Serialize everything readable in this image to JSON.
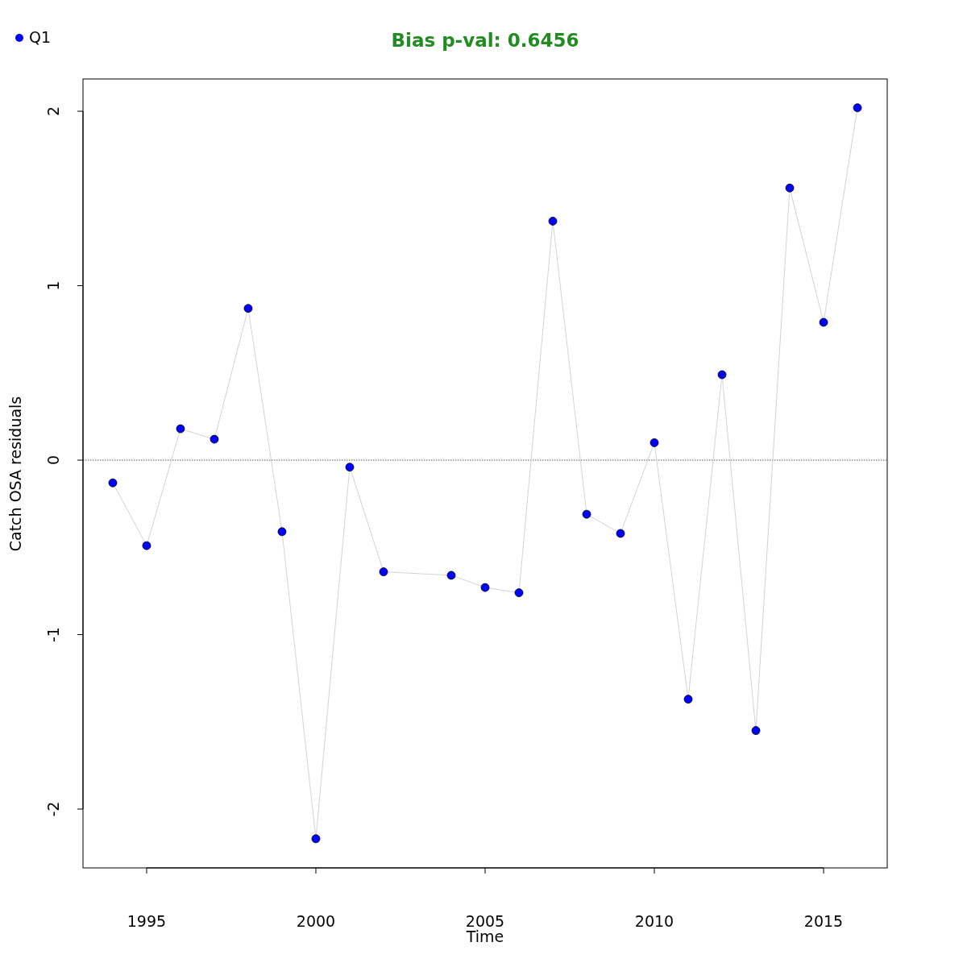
{
  "chart_data": {
    "type": "line",
    "title": "Bias p-val: 0.6456",
    "xlabel": "Time",
    "ylabel": "Catch OSA residuals",
    "x": [
      1994,
      1995,
      1996,
      1997,
      1998,
      1999,
      2000,
      2001,
      2002,
      2004,
      2005,
      2006,
      2007,
      2008,
      2009,
      2010,
      2011,
      2012,
      2013,
      2014,
      2015,
      2016
    ],
    "series": [
      {
        "name": "Q1",
        "color": "#0000ff",
        "marker": "circle",
        "values": [
          -0.13,
          -0.49,
          0.18,
          0.12,
          0.87,
          -0.41,
          -2.17,
          -0.04,
          -0.64,
          -0.66,
          -0.73,
          -0.76,
          1.37,
          -0.31,
          -0.42,
          0.1,
          -1.37,
          0.49,
          -1.55,
          1.56,
          0.79,
          2.02
        ]
      }
    ],
    "xlim": [
      1993.12,
      2016.88
    ],
    "ylim": [
      -2.337,
      2.185
    ],
    "xticks": [
      1995,
      2000,
      2005,
      2010,
      2015
    ],
    "yticks": [
      -2,
      -1,
      0,
      1,
      2
    ],
    "ref_lines": [
      {
        "axis": "y",
        "value": 0
      }
    ]
  }
}
